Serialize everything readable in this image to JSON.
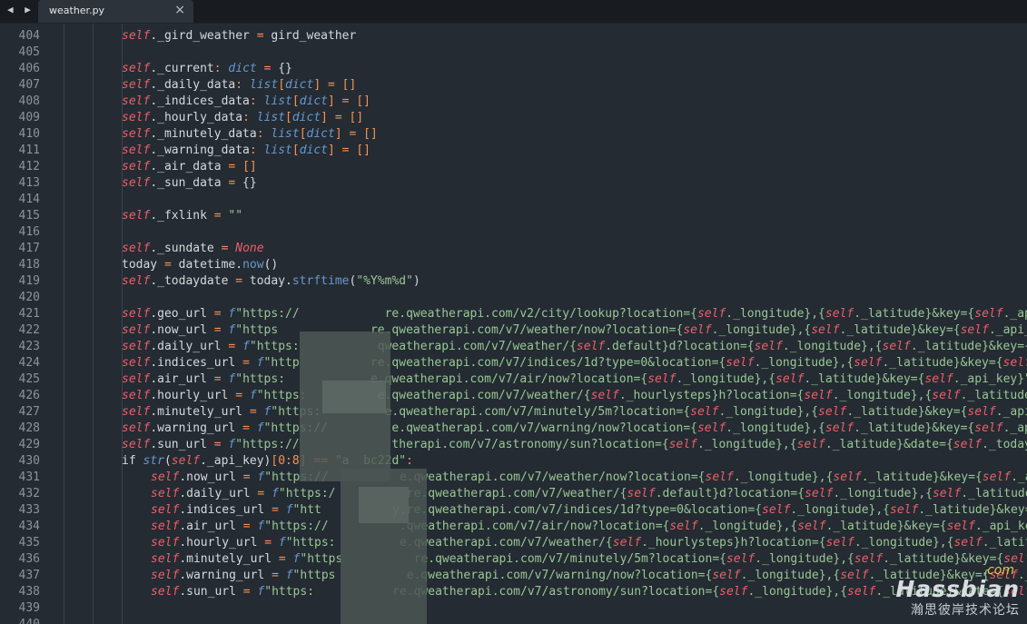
{
  "tab": {
    "filename": "weather.py",
    "close_glyph": "×"
  },
  "nav": {
    "arrows": "◀ ▶"
  },
  "editor": {
    "lines": [
      {
        "n": "404",
        "code": "    self._gird_weather = gird_weather"
      },
      {
        "n": "405",
        "code": ""
      },
      {
        "n": "406",
        "code": "    self._current: dict = {}"
      },
      {
        "n": "407",
        "code": "    self._daily_data: list[dict] = []"
      },
      {
        "n": "408",
        "code": "    self._indices_data: list[dict] = []"
      },
      {
        "n": "409",
        "code": "    self._hourly_data: list[dict] = []"
      },
      {
        "n": "410",
        "code": "    self._minutely_data: list[dict] = []"
      },
      {
        "n": "411",
        "code": "    self._warning_data: list[dict] = []"
      },
      {
        "n": "412",
        "code": "    self._air_data = []"
      },
      {
        "n": "413",
        "code": "    self._sun_data = {}"
      },
      {
        "n": "414",
        "code": ""
      },
      {
        "n": "415",
        "code": "    self._fxlink = \"\""
      },
      {
        "n": "416",
        "code": ""
      },
      {
        "n": "417",
        "code": "    self._sundate = None"
      },
      {
        "n": "418",
        "code": "    today = datetime.now()"
      },
      {
        "n": "419",
        "code": "    self._todaydate = today.strftime(\"%Y%m%d\")"
      },
      {
        "n": "420",
        "code": ""
      },
      {
        "n": "421",
        "code": "    self.geo_url = f\"https://            re.qweatherapi.com/v2/city/lookup?location={self._longitude},{self._latitude}&key={self._api_key}\""
      },
      {
        "n": "422",
        "code": "    self.now_url = f\"https             re.qweatherapi.com/v7/weather/now?location={self._longitude},{self._latitude}&key={self._api_key}\""
      },
      {
        "n": "423",
        "code": "    self.daily_url = f\"https:           qweatherapi.com/v7/weather/{self.default}d?location={self._longitude},{self._latitude}&key={self._api_key}\""
      },
      {
        "n": "424",
        "code": "    self.indices_url = f\"http          re.qweatherapi.com/v7/indices/1d?type=0&location={self._longitude},{self._latitude}&key={self._api_key}\""
      },
      {
        "n": "425",
        "code": "    self.air_url = f\"https:            e.qweatherapi.com/v7/air/now?location={self._longitude},{self._latitude}&key={self._api_key}\""
      },
      {
        "n": "426",
        "code": "    self.hourly_url = f\"https:          e.qweatherapi.com/v7/weather/{self._hourlysteps}h?location={self._longitude},{self._latitude}&key={self._api_key}\""
      },
      {
        "n": "427",
        "code": "    self.minutely_url = f\"https:         e.qweatherapi.com/v7/minutely/5m?location={self._longitude},{self._latitude}&key={self._api_key}\""
      },
      {
        "n": "428",
        "code": "    self.warning_url = f\"https://         e.qweatherapi.com/v7/warning/now?location={self._longitude},{self._latitude}&key={self._api_key}\""
      },
      {
        "n": "429",
        "code": "    self.sun_url = f\"https://             therapi.com/v7/astronomy/sun?location={self._longitude},{self._latitude}&date={self._todaydate}&key={self._api_key}\""
      },
      {
        "n": "430",
        "code": "    if str(self._api_key)[0:8] == \"a  bc22d\":"
      },
      {
        "n": "431",
        "code": "        self.now_url = f\"https://          e.qweatherapi.com/v7/weather/now?location={self._longitude},{self._latitude}&key={self._api_key}\""
      },
      {
        "n": "432",
        "code": "        self.daily_url = f\"https:/          re.qweatherapi.com/v7/weather/{self.default}d?location={self._longitude},{self._latitude}&key={self._api_key}\""
      },
      {
        "n": "433",
        "code": "        self.indices_url = f\"htt          y.re.qweatherapi.com/v7/indices/1d?type=0&location={self._longitude},{self._latitude}&key={self._api_key}\""
      },
      {
        "n": "434",
        "code": "        self.air_url = f\"https://          .qweatherapi.com/v7/air/now?location={self._longitude},{self._latitude}&key={self._api_key}\""
      },
      {
        "n": "435",
        "code": "        self.hourly_url = f\"https:         e.qweatherapi.com/v7/weather/{self._hourlysteps}h?location={self._longitude},{self._latitude}&key={self._api_key}\""
      },
      {
        "n": "436",
        "code": "        self.minutely_url = f\"https          re.qweatherapi.com/v7/minutely/5m?location={self._longitude},{self._latitude}&key={self._api_key}\""
      },
      {
        "n": "437",
        "code": "        self.warning_url = f\"https          e.qweatherapi.com/v7/warning/now?location={self._longitude},{self._latitude}&key={self._api_key}\""
      },
      {
        "n": "438",
        "code": "        self.sun_url = f\"https:           re.qweatherapi.com/v7/astronomy/sun?location={self._longitude},{self._latitude}&date={self._todaydate}&key={self._api_key}\""
      },
      {
        "n": "439",
        "code": ""
      },
      {
        "n": "440",
        "code": ""
      }
    ]
  },
  "watermark": {
    "com": ".com",
    "main": "Hassbian",
    "sub": "瀚思彼岸技术论坛"
  },
  "colors": {
    "self": "#ec5f67",
    "type": "#6699cc",
    "string": "#99c794",
    "operator": "#f99157",
    "background": "#242b33",
    "line_number": "#8b939c"
  }
}
